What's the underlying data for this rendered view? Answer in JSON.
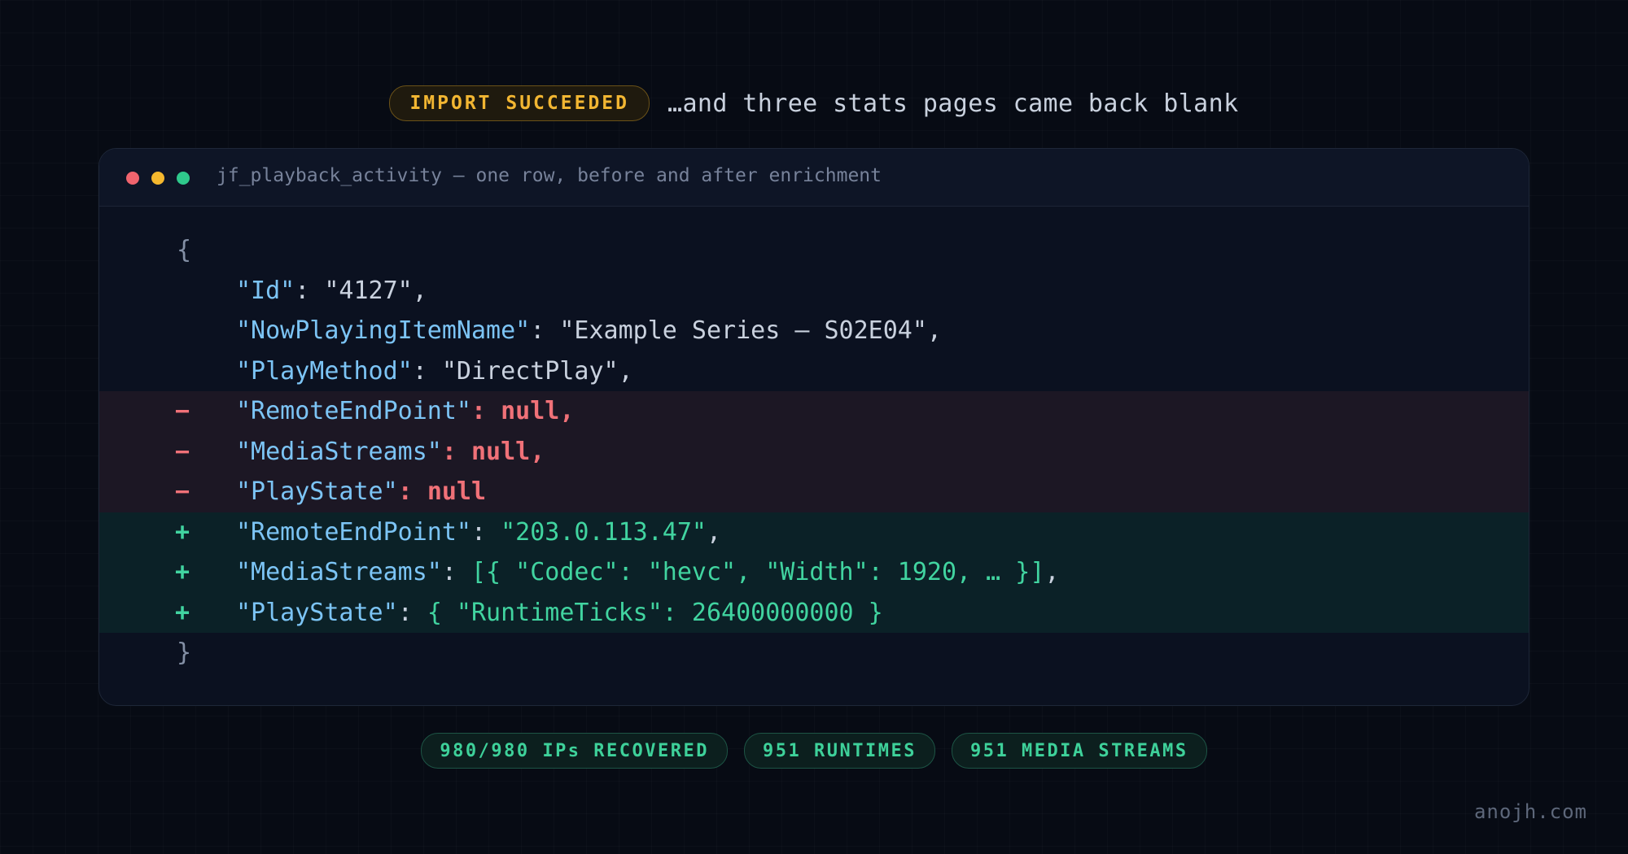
{
  "header": {
    "badge": "IMPORT SUCCEEDED",
    "text": "…and three stats pages came back blank"
  },
  "window": {
    "title": "jf_playback_activity — one row, before and after enrichment"
  },
  "code": {
    "open_brace": "{",
    "close_brace": "}",
    "lines": [
      {
        "type": "context",
        "key": "\"Id\"",
        "value": "\"4127\"",
        "trail": ","
      },
      {
        "type": "context",
        "key": "\"NowPlayingItemName\"",
        "value": "\"Example Series — S02E04\"",
        "trail": ","
      },
      {
        "type": "context",
        "key": "\"PlayMethod\"",
        "value": "\"DirectPlay\"",
        "trail": ","
      },
      {
        "type": "removed",
        "marker": "−",
        "key": "\"RemoteEndPoint\"",
        "value": "null",
        "trail": ","
      },
      {
        "type": "removed",
        "marker": "−",
        "key": "\"MediaStreams\"",
        "value": "null",
        "trail": ","
      },
      {
        "type": "removed",
        "marker": "−",
        "key": "\"PlayState\"",
        "value": "null",
        "trail": ""
      },
      {
        "type": "added",
        "marker": "+",
        "key": "\"RemoteEndPoint\"",
        "value": "\"203.0.113.47\"",
        "trail": ","
      },
      {
        "type": "added",
        "marker": "+",
        "key": "\"MediaStreams\"",
        "value": "[{ \"Codec\": \"hevc\", \"Width\": 1920, … }]",
        "trail": ","
      },
      {
        "type": "added",
        "marker": "+",
        "key": "\"PlayState\"",
        "value": "{ \"RuntimeTicks\": 26400000000 }",
        "trail": ""
      }
    ]
  },
  "stats": [
    "980/980 IPs RECOVERED",
    "951 RUNTIMES",
    "951 MEDIA STREAMS"
  ],
  "footer": {
    "site": "anojh.com"
  },
  "colors": {
    "background": "#070b14",
    "warn_accent": "#f2b632",
    "success_accent": "#3ed19a",
    "removed_accent": "#f07178",
    "key_color": "#7cc4f5"
  }
}
